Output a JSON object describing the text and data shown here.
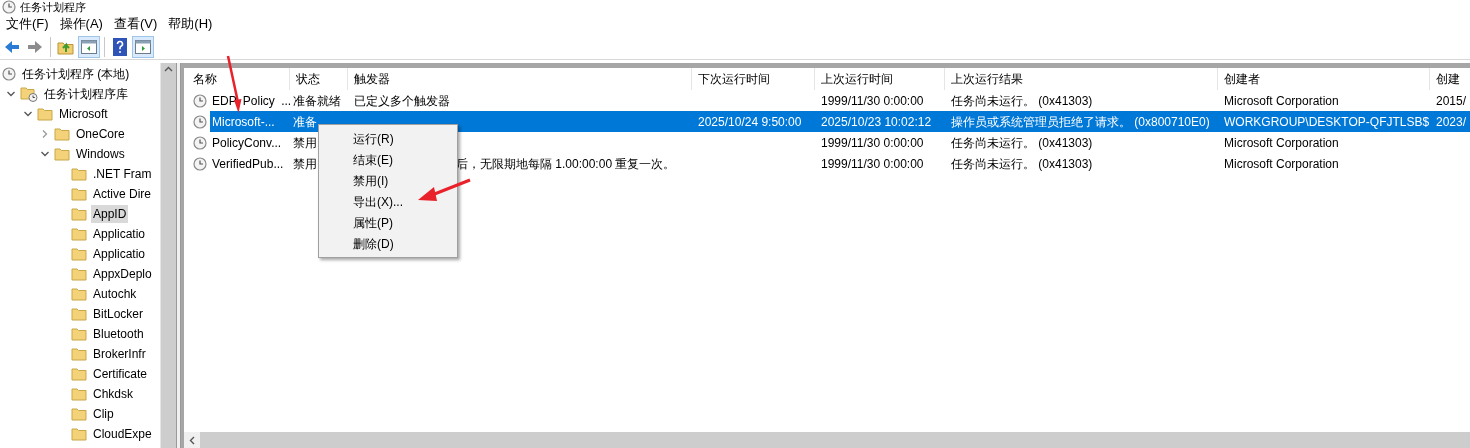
{
  "window": {
    "title": "任务计划程序"
  },
  "menu": [
    "文件(F)",
    "操作(A)",
    "查看(V)",
    "帮助(H)"
  ],
  "toolbar": [
    {
      "kind": "back",
      "disabled": false
    },
    {
      "kind": "forward",
      "disabled": true
    },
    {
      "kind": "separator"
    },
    {
      "kind": "up",
      "pressed": false
    },
    {
      "kind": "tree-pane",
      "pressed": true
    },
    {
      "kind": "separator"
    },
    {
      "kind": "help",
      "pressed": false
    },
    {
      "kind": "action-pane",
      "pressed": true
    }
  ],
  "tree": [
    {
      "label": "任务计划程序 (本地)",
      "kind": "root",
      "selected": false,
      "children": [
        {
          "label": "任务计划程序库",
          "kind": "library",
          "expanded": true,
          "selected": false,
          "children": [
            {
              "label": "Microsoft",
              "kind": "folder",
              "expanded": true,
              "selected": false,
              "children": [
                {
                  "label": "OneCore",
                  "kind": "folder",
                  "expanded": false,
                  "selected": false
                },
                {
                  "label": "Windows",
                  "kind": "folder",
                  "expanded": true,
                  "selected": false,
                  "children": [
                    {
                      "label": ".NET Fram",
                      "kind": "folder",
                      "selected": false
                    },
                    {
                      "label": "Active Dire",
                      "kind": "folder",
                      "selected": false
                    },
                    {
                      "label": "AppID",
                      "kind": "folder",
                      "selected": true
                    },
                    {
                      "label": "Applicatio",
                      "kind": "folder",
                      "selected": false
                    },
                    {
                      "label": "Applicatio",
                      "kind": "folder",
                      "selected": false
                    },
                    {
                      "label": "AppxDeplo",
                      "kind": "folder",
                      "selected": false
                    },
                    {
                      "label": "Autochk",
                      "kind": "folder",
                      "selected": false
                    },
                    {
                      "label": "BitLocker",
                      "kind": "folder",
                      "selected": false
                    },
                    {
                      "label": "Bluetooth",
                      "kind": "folder",
                      "selected": false
                    },
                    {
                      "label": "BrokerInfr",
                      "kind": "folder",
                      "selected": false
                    },
                    {
                      "label": "Certificate",
                      "kind": "folder",
                      "selected": false
                    },
                    {
                      "label": "Chkdsk",
                      "kind": "folder",
                      "selected": false
                    },
                    {
                      "label": "Clip",
                      "kind": "folder",
                      "selected": false
                    },
                    {
                      "label": "CloudExpe",
                      "kind": "folder",
                      "selected": false
                    }
                  ]
                }
              ]
            }
          ]
        }
      ]
    }
  ],
  "table": {
    "columns": [
      "名称",
      "状态",
      "触发器",
      "下次运行时间",
      "上次运行时间",
      "上次运行结果",
      "创建者",
      "创建"
    ],
    "rows": [
      {
        "selected": false,
        "cells": [
          "EDP Policy ...",
          "准备就绪",
          "已定义多个触发器",
          "",
          "1999/11/30 0:00:00",
          "任务尚未运行。 (0x41303)",
          "Microsoft Corporation",
          "2015/"
        ]
      },
      {
        "selected": true,
        "cells": [
          "Microsoft-...",
          "准备",
          "",
          "2025/10/24 9:50:00",
          "2025/10/23 10:02:12",
          "操作员或系统管理员拒绝了请求。 (0x800710E0)",
          "WORKGROUP\\DESKTOP-QFJTLSB$",
          "2023/"
        ]
      },
      {
        "selected": false,
        "cells": [
          "PolicyConv...",
          "禁用",
          "",
          "",
          "1999/11/30 0:00:00",
          "任务尚未运行。 (0x41303)",
          "Microsoft Corporation",
          ""
        ]
      },
      {
        "selected": false,
        "cells": [
          "VerifiedPub...",
          "禁用",
          "后，无限期地每隔 1.00:00:00 重复一次。",
          "",
          "1999/11/30 0:00:00",
          "任务尚未运行。 (0x41303)",
          "Microsoft Corporation",
          ""
        ]
      }
    ]
  },
  "context_menu": [
    "运行(R)",
    "结束(E)",
    "禁用(I)",
    "导出(X)...",
    "属性(P)",
    "删除(D)"
  ]
}
